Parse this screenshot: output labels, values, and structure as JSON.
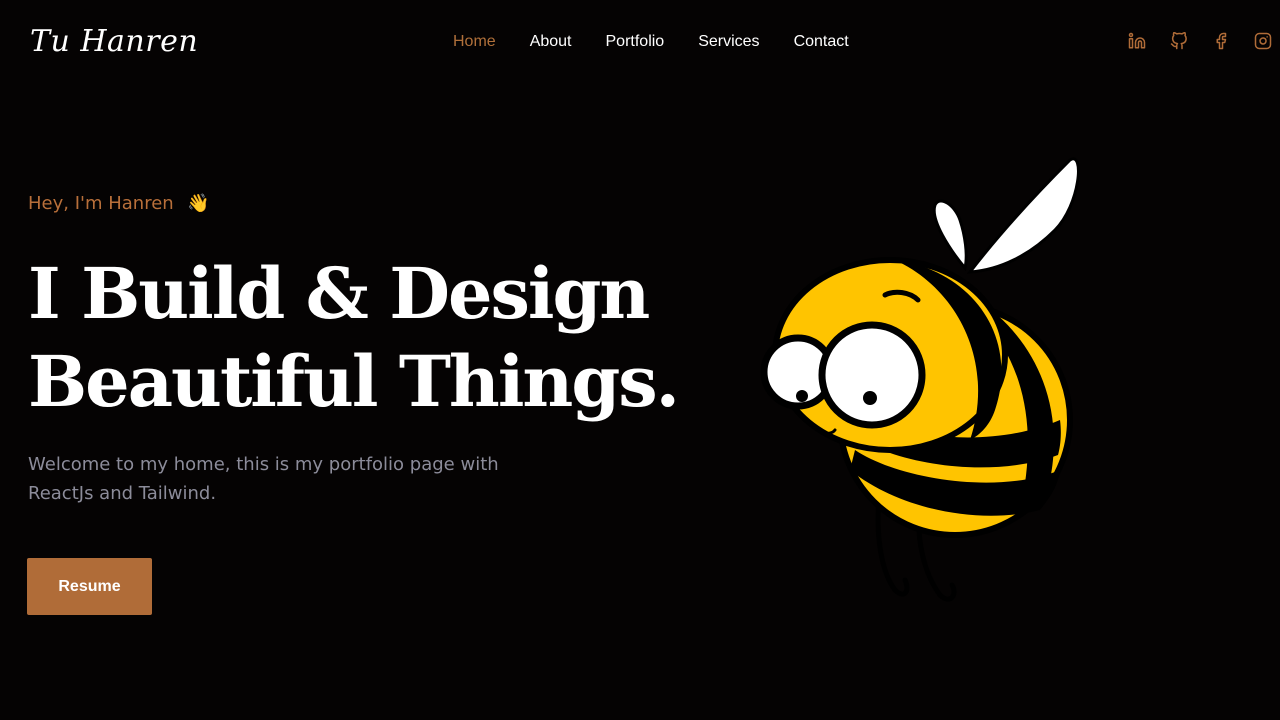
{
  "header": {
    "logo": "Tu Hanren",
    "nav": [
      {
        "label": "Home",
        "active": true
      },
      {
        "label": "About",
        "active": false
      },
      {
        "label": "Portfolio",
        "active": false
      },
      {
        "label": "Services",
        "active": false
      },
      {
        "label": "Contact",
        "active": false
      }
    ],
    "socials": [
      "linkedin-icon",
      "github-icon",
      "facebook-icon",
      "instagram-icon"
    ]
  },
  "hero": {
    "greeting": "Hey, I'm Hanren",
    "greeting_emoji": "👋",
    "headline_line1": "I Build & Design",
    "headline_line2": "Beautiful Things.",
    "intro": "Welcome to my home, this is my portfolio page with ReactJs and Tailwind.",
    "resume_label": "Resume"
  },
  "colors": {
    "background": "#050303",
    "accent": "#b06c38",
    "text": "#ffffff",
    "muted": "#8c8c9a",
    "bee_yellow": "#ffc400"
  }
}
